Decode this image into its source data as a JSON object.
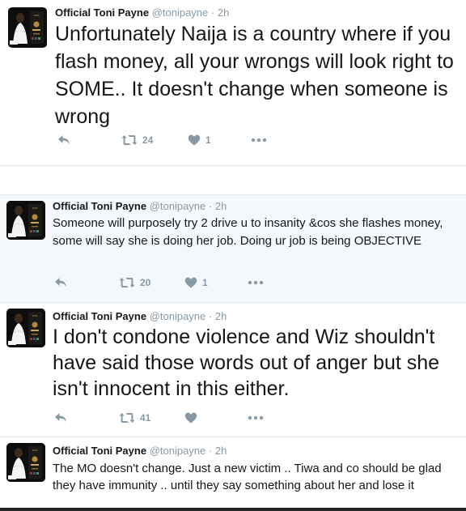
{
  "tweets": [
    {
      "name": "Official Toni Payne",
      "handle": "@tonipayne",
      "separator": "·",
      "time": "2h",
      "text": "Unfortunately Naija is a country where if you flash money, all your wrongs will look right to SOME.. It doesn't change when someone is wrong",
      "retweets": "24",
      "likes": "1"
    },
    {
      "name": "Official Toni Payne",
      "handle": "@tonipayne",
      "separator": "·",
      "time": "2h",
      "text": "Someone will purposely try 2 drive u to insanity &cos she flashes money, some will say she is doing her job. Doing ur job is being OBJECTIVE",
      "retweets": "20",
      "likes": "1"
    },
    {
      "name": "Official Toni Payne",
      "handle": "@tonipayne",
      "separator": "·",
      "time": "2h",
      "text": "I don't condone violence and Wiz shouldn't have said those words out of anger but she isn't innocent in this either.",
      "retweets": "41",
      "likes": ""
    },
    {
      "name": "Official Toni Payne",
      "handle": "@tonipayne",
      "separator": "·",
      "time": "2h",
      "text": "The MO doesn't change. Just a new victim .. Tiwa and co should be glad they have immunity .. until they say something about her and lose it"
    }
  ],
  "icons": {
    "reply": "reply-icon",
    "retweet": "retweet-icon",
    "like": "heart-icon",
    "more": "more-icon"
  },
  "colors": {
    "name": "#14171a",
    "meta": "#8899a6",
    "highlight_bg": "#f5f8fa",
    "border": "#e1e8ed"
  }
}
